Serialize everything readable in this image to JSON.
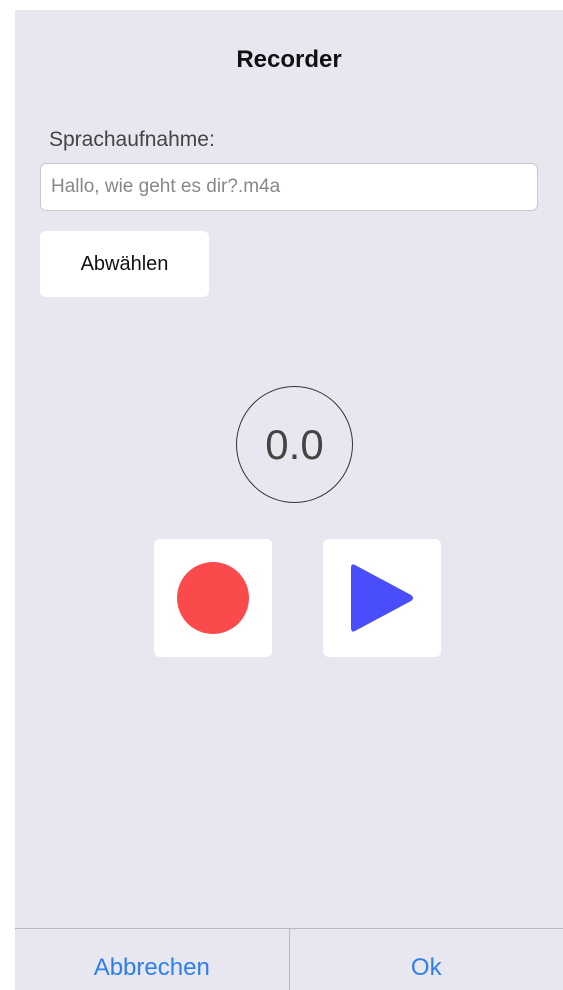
{
  "dialog": {
    "title": "Recorder"
  },
  "recording": {
    "label": "Sprachaufnahme:",
    "file_value": "Hallo, wie geht es dir?.m4a",
    "deselect_label": "Abwählen"
  },
  "player": {
    "elapsed": "0.0",
    "record_icon": "record-icon",
    "play_icon": "play-icon",
    "record_color": "#fa4a4c",
    "play_color": "#4a4dfb"
  },
  "footer": {
    "cancel_label": "Abbrechen",
    "ok_label": "Ok",
    "accent_color": "#2d7ff0"
  }
}
